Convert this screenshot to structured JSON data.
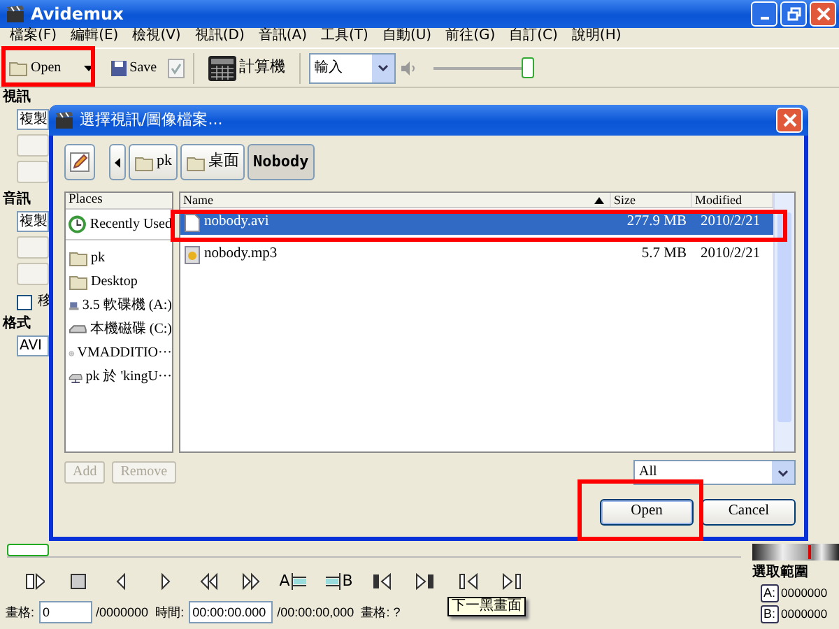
{
  "window": {
    "title": "Avidemux"
  },
  "menu": [
    {
      "label": "檔案(F)"
    },
    {
      "label": "編輯(E)"
    },
    {
      "label": "檢視(V)"
    },
    {
      "label": "視訊(D)"
    },
    {
      "label": "音訊(A)"
    },
    {
      "label": "工具(T)"
    },
    {
      "label": "自動(U)"
    },
    {
      "label": "前往(G)"
    },
    {
      "label": "自訂(C)"
    },
    {
      "label": "說明(H)"
    }
  ],
  "toolbar": {
    "open": {
      "label": "Open"
    },
    "save": {
      "label": "Save"
    },
    "calculator": {
      "label": "計算機"
    },
    "mode": {
      "value": "輸入"
    },
    "volume": {
      "level": 1
    }
  },
  "side_panel": {
    "video_heading": "視訊",
    "video_codec": "複製",
    "audio_heading": "音訊",
    "audio_codec": "複製",
    "option": {
      "label": "移",
      "checked": false
    },
    "format_heading": "格式",
    "format_value": "AVI"
  },
  "dialog": {
    "title": "選擇視訊/圖像檔案...",
    "path": [
      {
        "label": "pk",
        "selected": false
      },
      {
        "label": "桌面",
        "selected": false
      },
      {
        "label": "Nobody",
        "selected": true
      }
    ],
    "places_header": "Places",
    "places": [
      {
        "kind": "recent",
        "label": "Recently Used"
      },
      {
        "kind": "folder",
        "label": "pk"
      },
      {
        "kind": "folder",
        "label": "Desktop"
      },
      {
        "kind": "floppy",
        "label": "3.5 軟碟機 (A:)"
      },
      {
        "kind": "drive",
        "label": "本機磁碟 (C:)"
      },
      {
        "kind": "cdrom",
        "label": "VMADDITIO···"
      },
      {
        "kind": "network",
        "label": "pk 於 'kingU···"
      }
    ],
    "columns": [
      {
        "label": "Name",
        "sorted": true
      },
      {
        "label": "Size",
        "sorted": false
      },
      {
        "label": "Modified",
        "sorted": false
      }
    ],
    "files": [
      {
        "kind": "video",
        "name": "nobody.avi",
        "size": "277.9 MB",
        "modified": "2010/2/21",
        "selected": true
      },
      {
        "kind": "audio",
        "name": "nobody.mp3",
        "size": "5.7 MB",
        "modified": "2010/2/21",
        "selected": false
      }
    ],
    "add_button": {
      "label": "Add",
      "disabled": true
    },
    "remove_button": {
      "label": "Remove",
      "disabled": true
    },
    "filter": {
      "value": "All"
    },
    "open_button": {
      "label": "Open"
    },
    "cancel_button": {
      "label": "Cancel"
    }
  },
  "timeline": {
    "level": 0
  },
  "player_buttons": [
    {
      "kind": "play"
    },
    {
      "kind": "stop"
    },
    {
      "kind": "prev"
    },
    {
      "kind": "next"
    },
    {
      "kind": "rewind"
    },
    {
      "kind": "forward"
    },
    {
      "kind": "marka",
      "label": "A"
    },
    {
      "kind": "markb",
      "label": "B"
    },
    {
      "kind": "first"
    },
    {
      "kind": "last"
    },
    {
      "kind": "prevblack"
    },
    {
      "kind": "nextblack"
    }
  ],
  "tooltip": "下一黑畫面",
  "selection": {
    "heading": "選取範圍",
    "a_label": "A:",
    "a_value": "0000000",
    "b_label": "B:",
    "b_value": "0000000"
  },
  "status": {
    "frame_label": "畫格:",
    "frame_value": "0",
    "frame_total": "/0000000",
    "time_label": "時間:",
    "time_value": "00:00:00.000",
    "time_total": "/00:00:00,000",
    "frame_type": "畫格: ?"
  }
}
